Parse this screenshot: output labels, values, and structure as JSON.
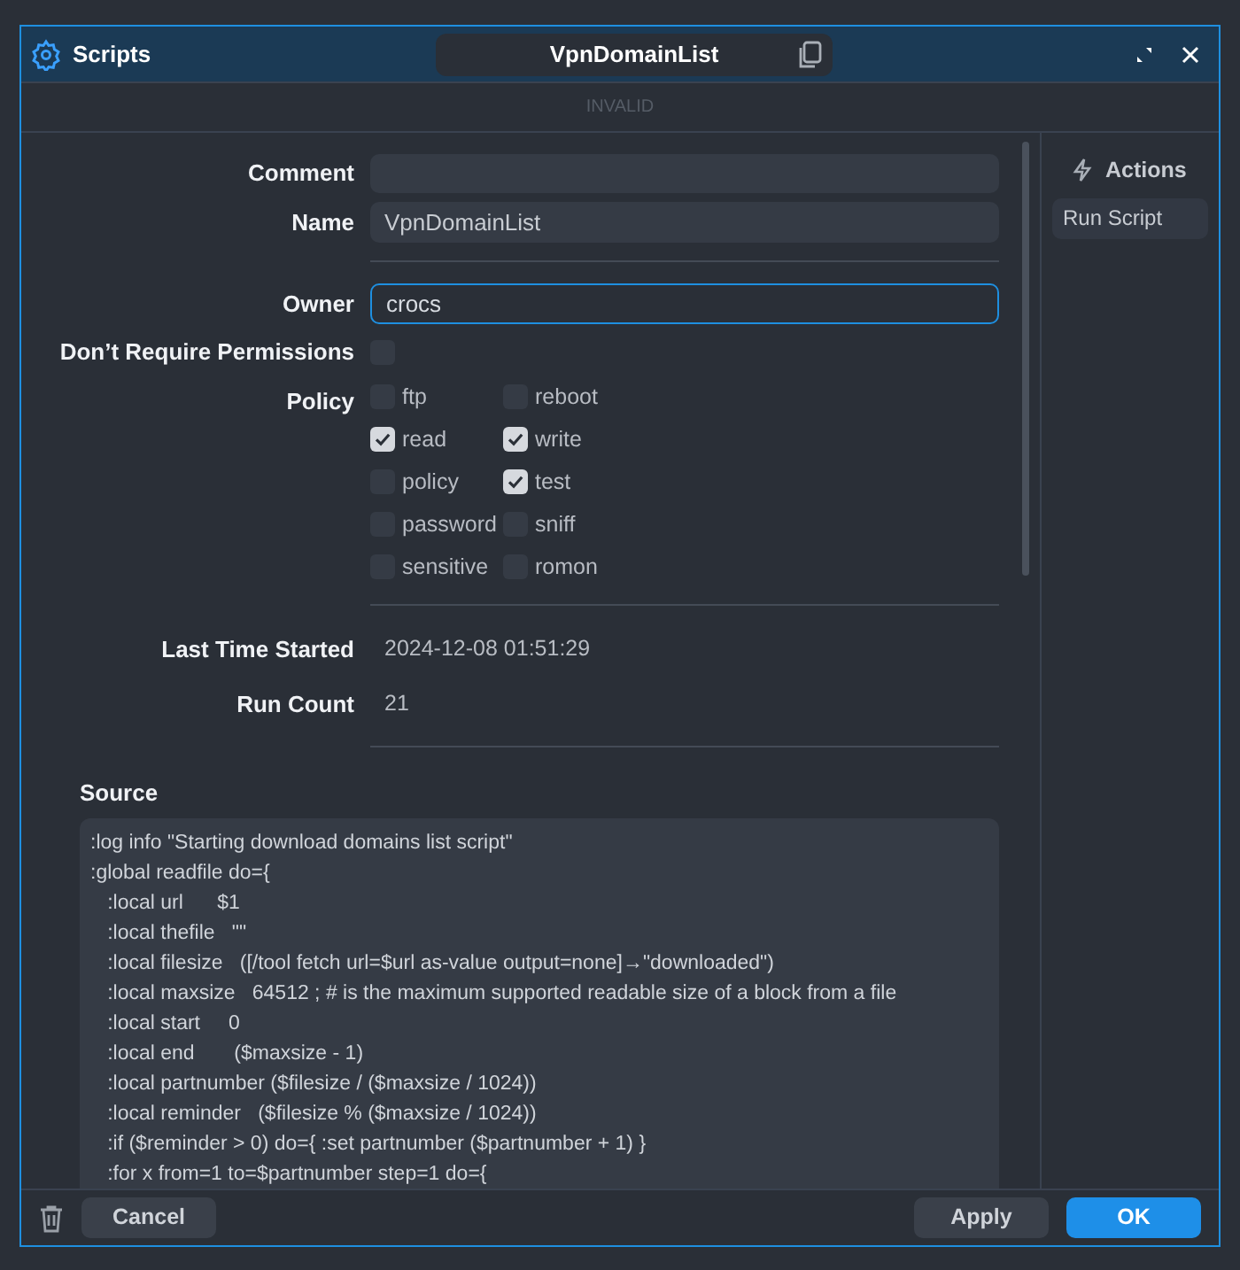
{
  "window": {
    "title": "Scripts",
    "record_name": "VpnDomainList"
  },
  "status": "INVALID",
  "form": {
    "comment": {
      "label": "Comment"
    },
    "name": {
      "label": "Name",
      "value": "VpnDomainList"
    },
    "owner": {
      "label": "Owner",
      "value": "crocs",
      "focused": true
    },
    "dont_require_permissions": {
      "label": "Don’t Require Permissions",
      "checked": false
    },
    "policy": {
      "label": "Policy",
      "options": [
        {
          "label": "ftp",
          "checked": false
        },
        {
          "label": "reboot",
          "checked": false
        },
        {
          "label": "read",
          "checked": true
        },
        {
          "label": "write",
          "checked": true
        },
        {
          "label": "policy",
          "checked": false
        },
        {
          "label": "test",
          "checked": true
        },
        {
          "label": "password",
          "checked": false
        },
        {
          "label": "sniff",
          "checked": false
        },
        {
          "label": "sensitive",
          "checked": false
        },
        {
          "label": "romon",
          "checked": false
        }
      ]
    },
    "last_time_started": {
      "label": "Last Time Started",
      "value": "2024-12-08 01:51:29"
    },
    "run_count": {
      "label": "Run Count",
      "value": "21"
    }
  },
  "source": {
    "label": "Source",
    "lines": [
      ":log info \"Starting download domains list script\"",
      ":global readfile do={",
      "   :local url      $1",
      "   :local thefile   \"\"",
      "   :local filesize   ([/tool fetch url=$url as-value output=none]→\"downloaded\")",
      "   :local maxsize   64512 ; # is the maximum supported readable size of a block from a file",
      "   :local start     0",
      "   :local end       ($maxsize - 1)",
      "   :local partnumber ($filesize / ($maxsize / 1024))",
      "   :local reminder   ($filesize % ($maxsize / 1024))",
      "   :if ($reminder > 0) do={ :set partnumber ($partnumber + 1) }",
      "   :for x from=1 to=$partnumber step=1 do={"
    ]
  },
  "actions": {
    "title": "Actions",
    "items": [
      "Run Script"
    ]
  },
  "footer": {
    "cancel": "Cancel",
    "apply": "Apply",
    "ok": "OK"
  }
}
